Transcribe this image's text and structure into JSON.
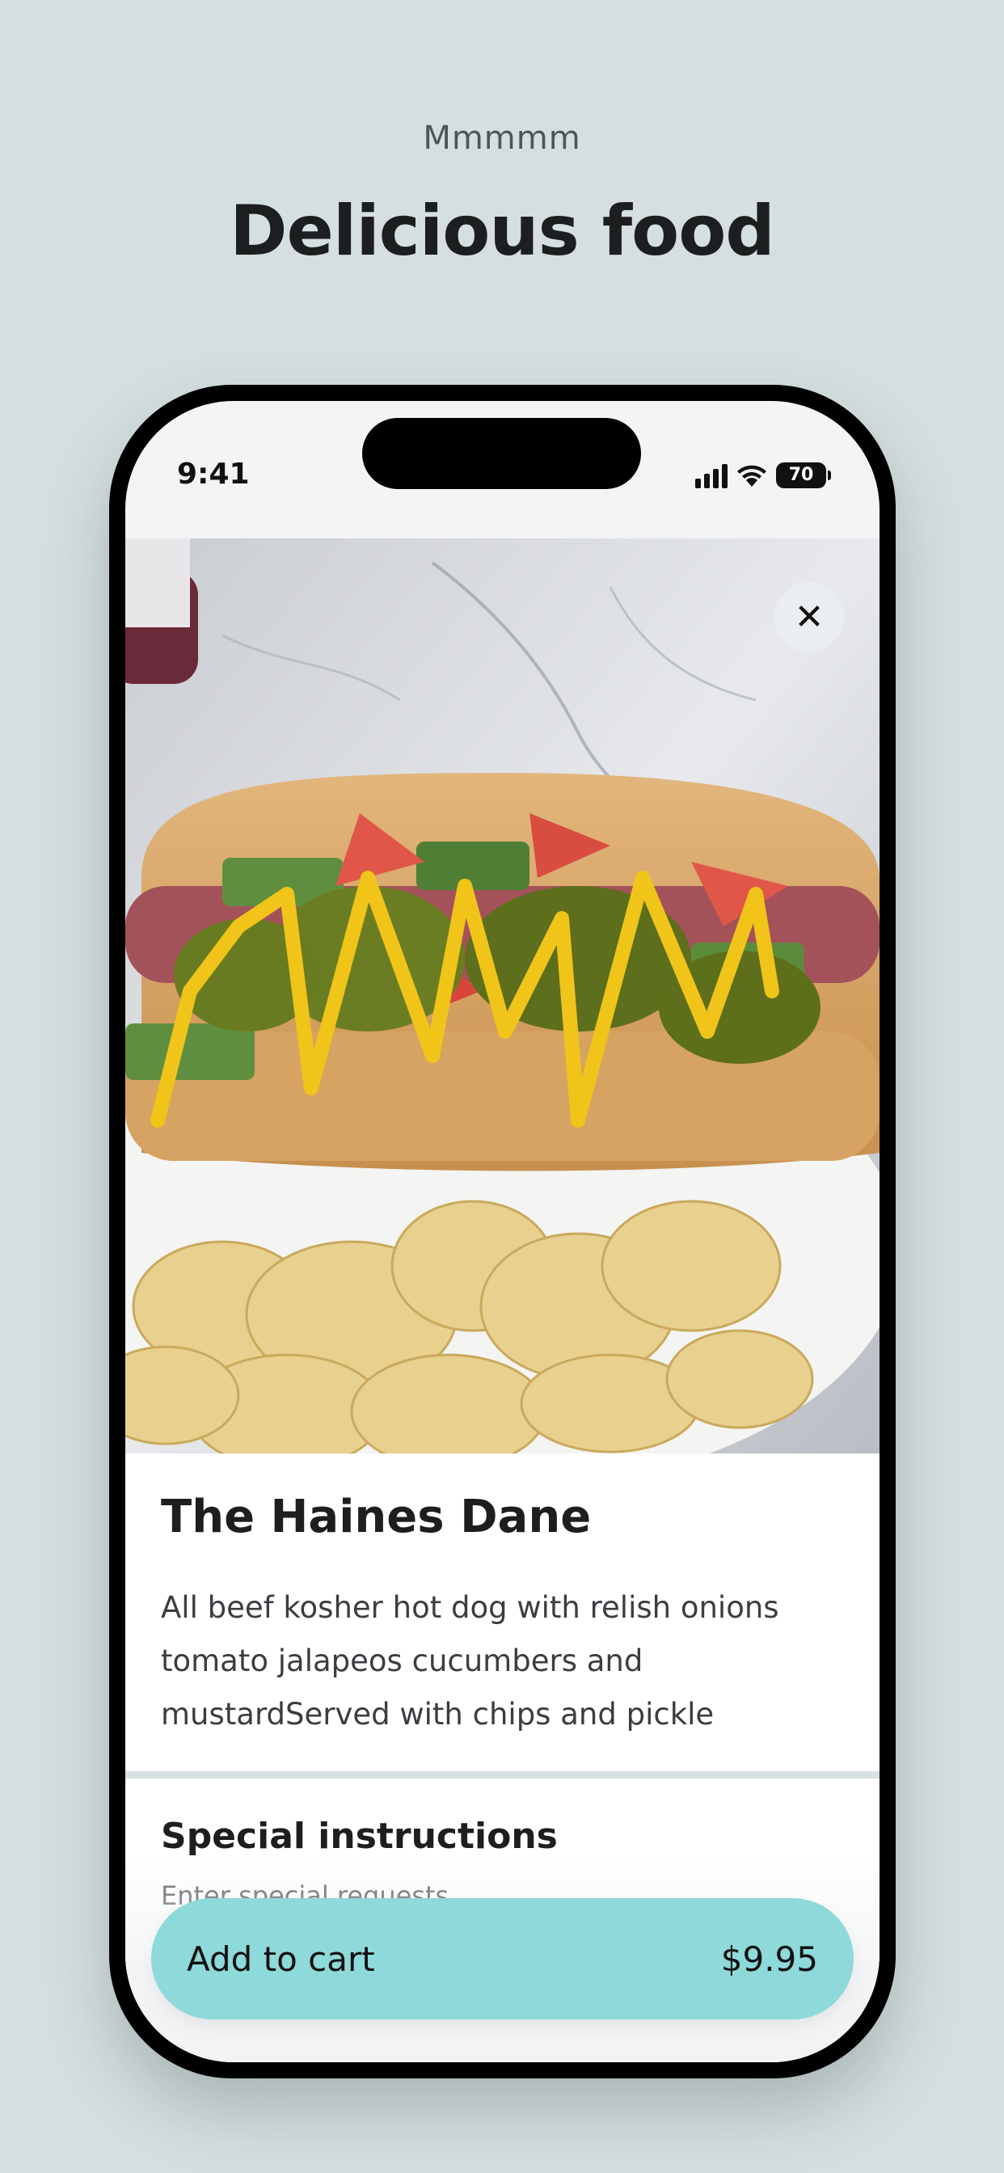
{
  "header": {
    "eyebrow": "Mmmmm",
    "title": "Delicious food"
  },
  "status_bar": {
    "time": "9:41",
    "battery": "70"
  },
  "item": {
    "name": "The Haines Dane",
    "description": "All beef kosher hot dog with relish onions tomato jalapeos cucumbers and mustardServed with chips and pickle",
    "close_icon": "✕"
  },
  "special_instructions": {
    "title": "Special instructions",
    "placeholder": "Enter special requests"
  },
  "cart": {
    "label": "Add to cart",
    "price": "$9.95"
  },
  "colors": {
    "background": "#d5dfe0",
    "accent": "#8ed9da"
  }
}
